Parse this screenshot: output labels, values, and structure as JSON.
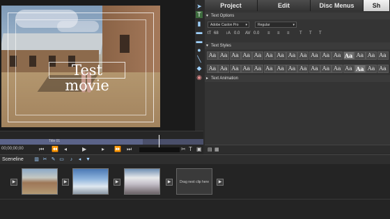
{
  "monitor": {
    "title_overlay": "Test movie",
    "timecode": "00;00;00;00",
    "clip_name": "Title 01"
  },
  "tabs": [
    "Project",
    "Edit",
    "Disc Menus",
    "Sh"
  ],
  "active_tab": "Sh",
  "text_options": {
    "header": "Text Options",
    "font": "Adobe Caslon Pro",
    "style": "Regular",
    "size": "68",
    "leading": "0.0",
    "kerning": "0.0"
  },
  "text_styles": {
    "header": "Text Styles",
    "row1": [
      "Aa",
      "Aa",
      "Aa",
      "Aa",
      "Aa",
      "Aa",
      "Aa",
      "Aa",
      "Aa",
      "Aa",
      "Aa",
      "Aa",
      "Aa",
      "Aa",
      "Aa",
      "Aa"
    ],
    "row2": [
      "Aa",
      "Aa",
      "Aa",
      "Aa",
      "Aa",
      "Aa",
      "Aa",
      "Aa",
      "Aa",
      "Aa",
      "Aa",
      "Aa",
      "Aa",
      "Aa",
      "Aa",
      "Aa"
    ]
  },
  "text_animation": {
    "header": "Text Animation"
  },
  "sceneline": {
    "label": "Sceneline",
    "drop_hint": "Drag next clip here"
  },
  "colors": {
    "active_tab": "#e0e0e0",
    "accent": "#9fd2ff"
  },
  "icons": [
    "selection-icon",
    "text-icon",
    "rectangle-icon",
    "ellipse-icon",
    "play-icon",
    "scissors-icon"
  ]
}
